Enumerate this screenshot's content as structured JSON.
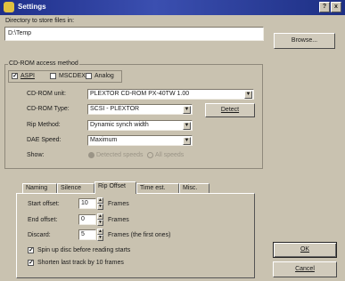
{
  "window": {
    "title": "Settings",
    "help": "?",
    "close": "x"
  },
  "directory": {
    "label": "Directory to store files in:",
    "value": "D:\\Temp",
    "browse": "Browse..."
  },
  "cdrom": {
    "group_label": "CD-ROM access method",
    "methods": [
      {
        "label": "ASPI",
        "checked": true
      },
      {
        "label": "MSCDEX",
        "checked": false
      },
      {
        "label": "Analog",
        "checked": false
      }
    ],
    "unit_label": "CD-ROM unit:",
    "unit_value": "PLEXTOR CD-ROM PX-40TW 1.00",
    "type_label": "CD-ROM Type:",
    "type_value": "SCSI - PLEXTOR",
    "detect": "Detect",
    "rip_label": "Rip Method:",
    "rip_value": "Dynamic synch width",
    "dae_label": "DAE Speed:",
    "dae_value": "Maximum",
    "show_label": "Show:",
    "show_options": [
      "Detected speeds",
      "All speeds"
    ]
  },
  "tabs": [
    "Naming",
    "Silence",
    "Rip Offset",
    "Time est.",
    "Misc."
  ],
  "active_tab": "Rip Offset",
  "rip_offset": {
    "start_label": "Start offset:",
    "start_value": "10",
    "start_unit": "Frames",
    "end_label": "End offset:",
    "end_value": "0",
    "end_unit": "Frames",
    "discard_label": "Discard:",
    "discard_value": "5",
    "discard_unit": "Frames (the first ones)",
    "spin_up": {
      "label": "Spin up disc before reading starts",
      "checked": true
    },
    "shorten": {
      "label": "Shorten last track by 10 frames",
      "checked": true
    }
  },
  "buttons": {
    "ok": "OK",
    "cancel": "Cancel"
  },
  "icons": {
    "up": "▲",
    "down": "▼",
    "check": "✓"
  },
  "colors": {
    "title_bar": "#1f2f8a",
    "face": "#c9c2b0"
  }
}
